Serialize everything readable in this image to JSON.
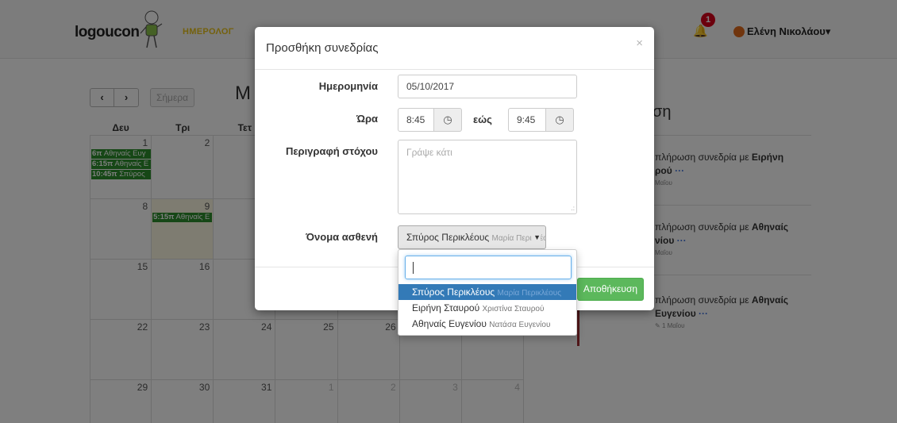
{
  "navbar": {
    "logo": "logoucon",
    "nav_link": "ΗΜΕΡΟΛΟΓ",
    "notification_count": "1",
    "user_name": "Ελένη Νικολάου"
  },
  "calendar": {
    "today_label": "Σήμερα",
    "month_partial": "Μ",
    "weekdays": [
      "Δευ",
      "Τρι",
      "Τετ"
    ],
    "rows": [
      [
        "1",
        "2",
        "",
        "",
        "",
        "",
        ""
      ],
      [
        "8",
        "9",
        "",
        "",
        "",
        "",
        ""
      ],
      [
        "15",
        "16",
        "",
        "",
        "",
        "",
        ""
      ],
      [
        "22",
        "23",
        "24",
        "25",
        "26",
        "",
        ""
      ],
      [
        "29",
        "30",
        "31",
        "1",
        "2",
        "3",
        "4"
      ]
    ],
    "events": [
      {
        "time": "6π",
        "name": "Αθηναίς Ευγ"
      },
      {
        "time": "6:15π",
        "name": "Αθηναίς Ε"
      },
      {
        "time": "10:45π",
        "name": "Σπύρος"
      },
      {
        "time": "5:15π",
        "name": "Αθηναίς Ε"
      }
    ]
  },
  "sidebar": {
    "title": "ση",
    "items": [
      {
        "text": "πλήρωση συνεδρία με ",
        "bold": "Ειρήνη",
        "bold2": "ρού",
        "meta": "Μαΐου"
      },
      {
        "text": "πλήρωση συνεδρία με ",
        "bold": "Αθηναίς",
        "bold2": "νίου",
        "meta": "Μαΐου"
      },
      {
        "text": "πλήρωση συνεδρία με ",
        "bold": "Αθηναίς",
        "bold2": "Ευγενίου",
        "meta": "1 Μαΐου"
      }
    ]
  },
  "modal": {
    "title": "Προσθήκη συνεδρίας",
    "close": "×",
    "date_label": "Ημερομηνία",
    "date_value": "05/10/2017",
    "time_label": "Ώρα",
    "time_from": "8:45",
    "time_to_label": "εώς",
    "time_to": "9:45",
    "goal_label": "Περιγραφή στόχου",
    "goal_placeholder": "Γράψε κάτι",
    "patient_label": "Όνομα ασθενή",
    "patient_selected_name": "Σπύρος Περικλέους",
    "patient_selected_sub": "Μαρία Περικλέους",
    "save_label": "Αποθήκευση"
  },
  "dropdown": {
    "options": [
      {
        "name": "Σπύρος Περικλέους",
        "sub": "Μαρία Περικλέους"
      },
      {
        "name": "Ειρήνη Σταυρού",
        "sub": "Χριστίνα Σταυρού"
      },
      {
        "name": "Αθηναίς Ευγενίου",
        "sub": "Νατάσα Ευγενίου"
      }
    ]
  },
  "icons": {
    "clock": "clock-icon",
    "bell": "bell-icon",
    "caret": "caret-down-icon"
  },
  "colors": {
    "primary": "#337ab7",
    "success": "#5cb85c",
    "event": "#2d8f2d",
    "nav_link": "#e8c21a",
    "badge": "#d9001b"
  }
}
